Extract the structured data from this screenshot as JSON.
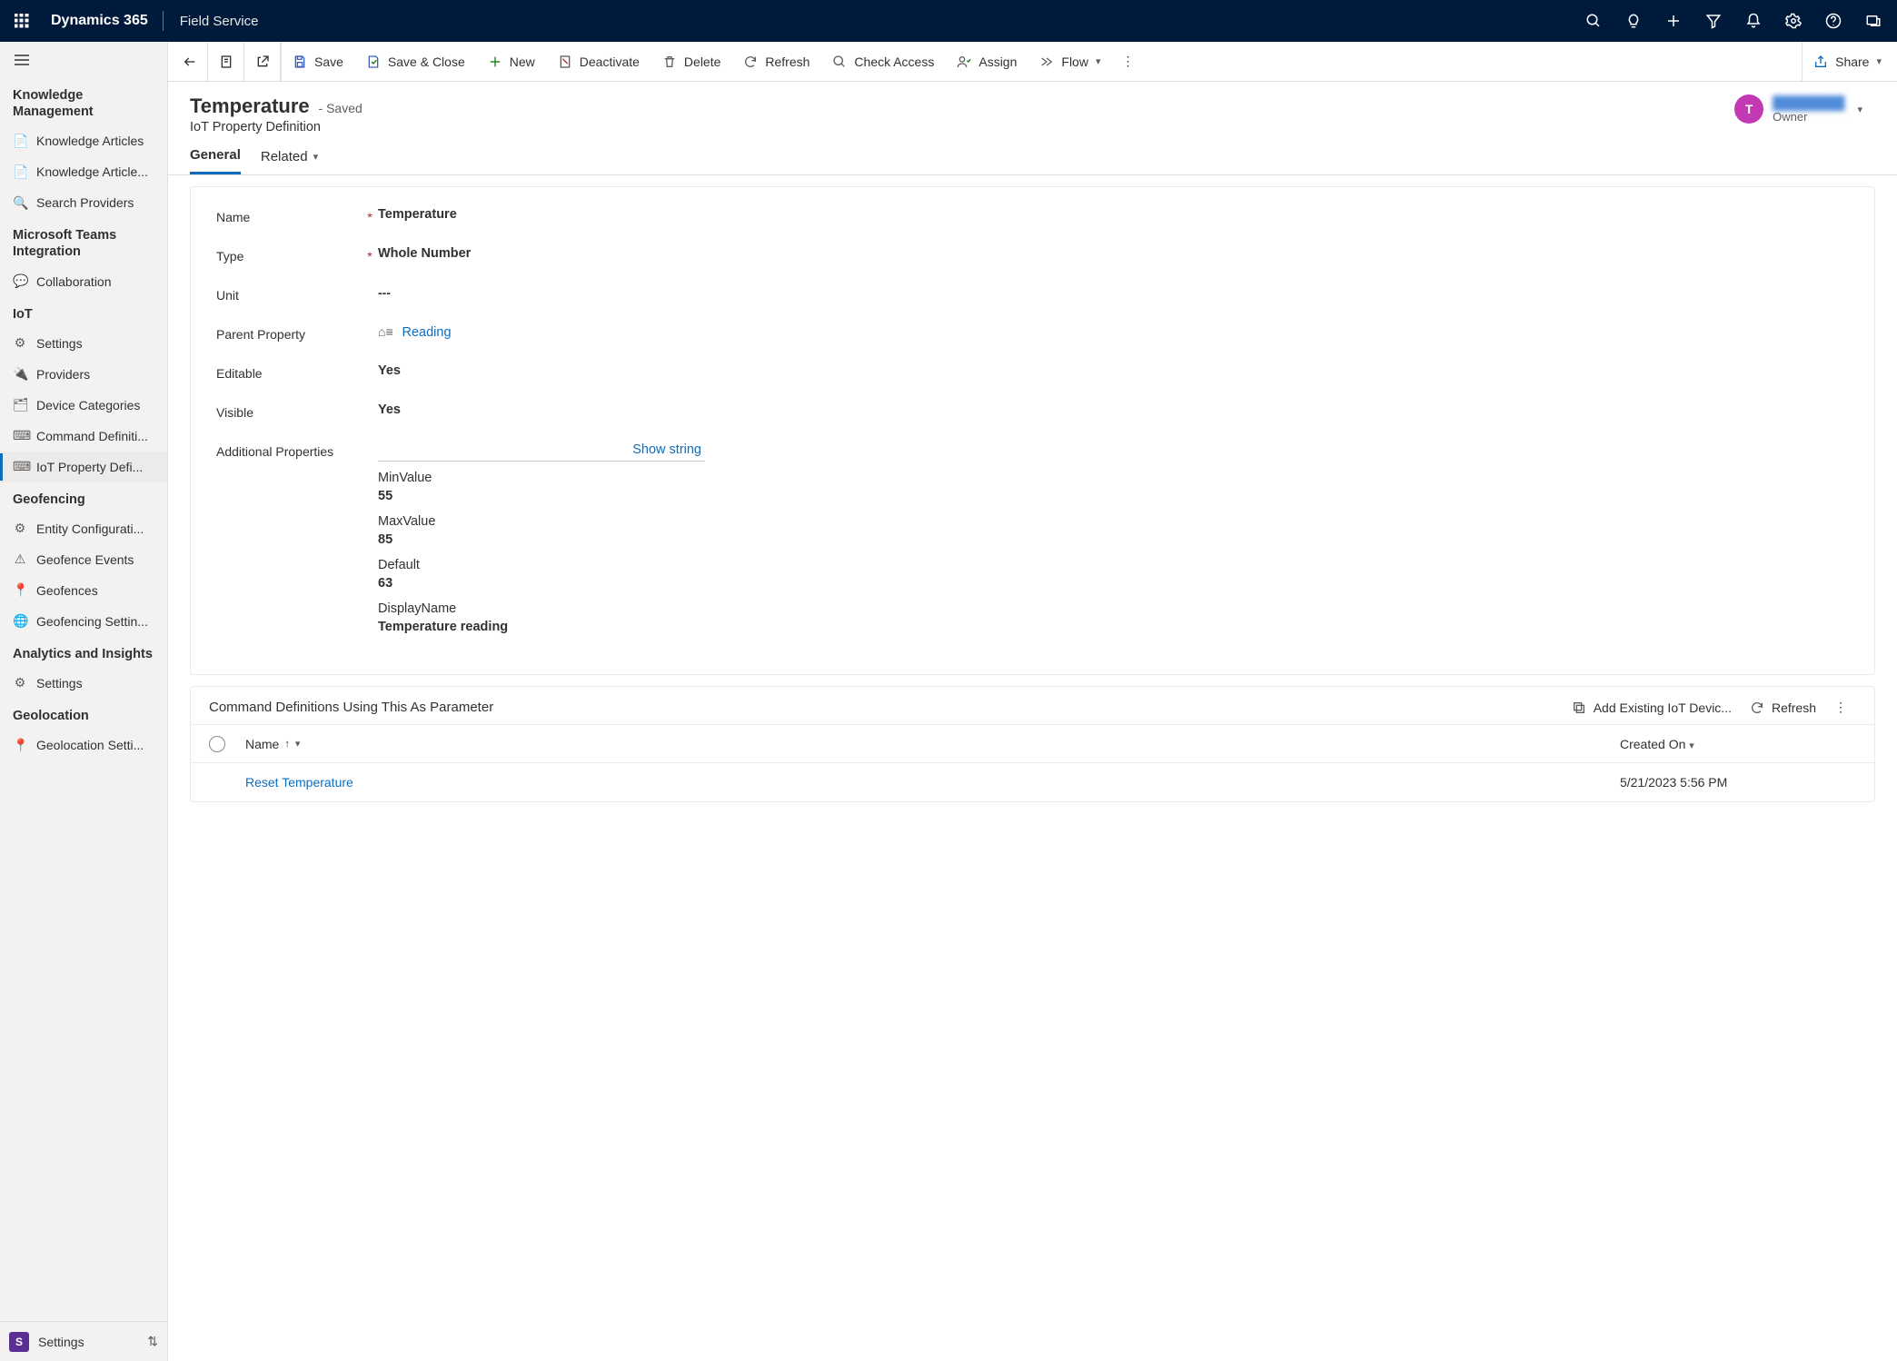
{
  "topbar": {
    "brand": "Dynamics 365",
    "app": "Field Service"
  },
  "sidebar": {
    "groups": [
      {
        "title": "Knowledge Management",
        "items": [
          {
            "label": "Knowledge Articles"
          },
          {
            "label": "Knowledge Article..."
          },
          {
            "label": "Search Providers"
          }
        ]
      },
      {
        "title": "Microsoft Teams Integration",
        "items": [
          {
            "label": "Collaboration"
          }
        ]
      },
      {
        "title": "IoT",
        "items": [
          {
            "label": "Settings"
          },
          {
            "label": "Providers"
          },
          {
            "label": "Device Categories"
          },
          {
            "label": "Command Definiti..."
          },
          {
            "label": "IoT Property Defi...",
            "selected": true
          }
        ]
      },
      {
        "title": "Geofencing",
        "items": [
          {
            "label": "Entity Configurati..."
          },
          {
            "label": "Geofence Events"
          },
          {
            "label": "Geofences"
          },
          {
            "label": "Geofencing Settin..."
          }
        ]
      },
      {
        "title": "Analytics and Insights",
        "items": [
          {
            "label": "Settings"
          }
        ]
      },
      {
        "title": "Geolocation",
        "items": [
          {
            "label": "Geolocation Setti..."
          }
        ]
      }
    ],
    "area": {
      "badge": "S",
      "label": "Settings"
    }
  },
  "cmdbar": {
    "save": "Save",
    "save_close": "Save & Close",
    "new": "New",
    "deactivate": "Deactivate",
    "delete": "Delete",
    "refresh": "Refresh",
    "check_access": "Check Access",
    "assign": "Assign",
    "flow": "Flow",
    "share": "Share"
  },
  "record": {
    "title": "Temperature",
    "saved": "- Saved",
    "subtitle": "IoT Property Definition",
    "owner_initial": "T",
    "owner_name": "████████",
    "owner_role": "Owner"
  },
  "tabs": {
    "general": "General",
    "related": "Related"
  },
  "fields": {
    "name_label": "Name",
    "name_value": "Temperature",
    "type_label": "Type",
    "type_value": "Whole Number",
    "unit_label": "Unit",
    "unit_value": "---",
    "parent_label": "Parent Property",
    "parent_value": "Reading",
    "editable_label": "Editable",
    "editable_value": "Yes",
    "visible_label": "Visible",
    "visible_value": "Yes",
    "addl_label": "Additional Properties",
    "show_string": "Show string",
    "addl_props": {
      "min_k": "MinValue",
      "min_v": "55",
      "max_k": "MaxValue",
      "max_v": "85",
      "def_k": "Default",
      "def_v": "63",
      "disp_k": "DisplayName",
      "disp_v": "Temperature reading"
    }
  },
  "subgrid": {
    "title": "Command Definitions Using This As Parameter",
    "add_existing": "Add Existing IoT Devic...",
    "refresh": "Refresh",
    "col_name": "Name",
    "col_created": "Created On",
    "row_name": "Reset Temperature",
    "row_created": "5/21/2023 5:56 PM"
  }
}
